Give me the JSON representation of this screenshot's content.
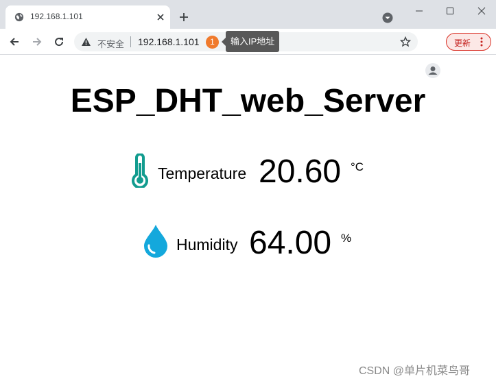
{
  "browser": {
    "tab_title": "192.168.1.101",
    "address_security": "不安全",
    "address_url": "192.168.1.101",
    "badge": "1",
    "tooltip": "输入IP地址",
    "update_label": "更新"
  },
  "page": {
    "title": "ESP_DHT_web_Server",
    "temperature": {
      "label": "Temperature",
      "value": "20.60",
      "unit": "°C",
      "icon": "thermometer-icon",
      "color": "#129c8f"
    },
    "humidity": {
      "label": "Humidity",
      "value": "64.00",
      "unit": "%",
      "icon": "water-drop-icon",
      "color": "#14a8dc"
    }
  },
  "watermark": "CSDN @单片机菜鸟哥"
}
